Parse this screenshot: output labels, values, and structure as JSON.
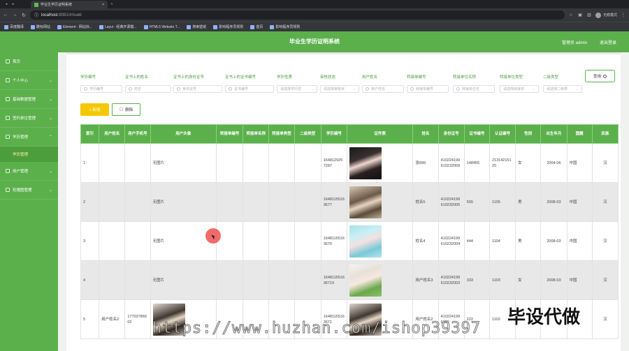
{
  "browser": {
    "tab_title": "毕业生学历证明系统",
    "url_host": "localhost",
    "url_path": ":8081/#/xueli",
    "profile": "无痕模式",
    "bookmarks": [
      "百度翻译",
      "酷标网站",
      "Element - 网站快...",
      "Layui - 经典开源模...",
      "HTML5 Website T...",
      "搜索壁纸",
      "影响程序员规则",
      "首页",
      "影响程序员规则"
    ]
  },
  "header": {
    "title": "毕业生学历证明系统",
    "user": "管理员 admin",
    "logout": "退出登录"
  },
  "sidebar": {
    "items": [
      {
        "label": "首页",
        "chevron": false
      },
      {
        "label": "个人中心",
        "chevron": true
      },
      {
        "label": "基础数据管理",
        "chevron": true
      },
      {
        "label": "签约单位管理",
        "chevron": true
      },
      {
        "label": "学历管理",
        "chevron": true
      }
    ],
    "sub_active": "学历管理",
    "items_after": [
      {
        "label": "用户管理",
        "chevron": true
      },
      {
        "label": "轮播图管理",
        "chevron": true
      }
    ]
  },
  "filters": [
    {
      "label": "学历编号",
      "placeholder": "学历编号",
      "type": "input"
    },
    {
      "label": "证书上的姓名",
      "placeholder": "姓名",
      "type": "input"
    },
    {
      "label": "证书上的身份证号",
      "placeholder": "身份证号",
      "type": "input"
    },
    {
      "label": "证书上的证书编号",
      "placeholder": "证书编号",
      "type": "input"
    },
    {
      "label": "学历性质",
      "placeholder": "请选择学历性",
      "type": "select"
    },
    {
      "label": "审核状态",
      "placeholder": "请选择审核状",
      "type": "select"
    },
    {
      "label": "用户姓名",
      "placeholder": "用户姓名",
      "type": "input"
    },
    {
      "label": "转接单编号",
      "placeholder": "转接单编号",
      "type": "input"
    },
    {
      "label": "转接单位名称",
      "placeholder": "转接单位名",
      "type": "input"
    },
    {
      "label": "转接单位类型",
      "placeholder": "请选择转接单",
      "type": "select"
    },
    {
      "label": "二级类型",
      "placeholder": "请选择二级类",
      "type": "select"
    }
  ],
  "buttons": {
    "query": "查询",
    "add": "+ 新增",
    "delete": "删除"
  },
  "table": {
    "columns": [
      "索引",
      "用户姓名",
      "用户手机号",
      "用户头像",
      "转接单编号",
      "转接单名称",
      "转接单类型",
      "二级类型",
      "学历编号",
      "证件照",
      "姓名",
      "身份证号",
      "证书编号",
      "认证编号",
      "性别",
      "出生年月",
      "国籍",
      "民族"
    ],
    "rows": [
      {
        "idx": "1",
        "uname": "",
        "phone": "",
        "avatar": "无图片",
        "no": "",
        "name": "",
        "type": "",
        "sub": "",
        "edu_no": "1648129257287",
        "photo": "p1",
        "cname": "张899",
        "idcard": "410224199610232009",
        "cert": "148455",
        "auth": "21314215125",
        "sex": "女",
        "birth": "2004-06",
        "nation": "中国",
        "ethnic": "汉"
      },
      {
        "idx": "2",
        "uname": "",
        "phone": "",
        "avatar": "无图片",
        "no": "",
        "name": "",
        "type": "",
        "sub": "",
        "edu_no": "16481155163677",
        "photo": "p2",
        "cname": "姓名5",
        "idcard": "410224199610232005",
        "cert": "555",
        "auth": "1105",
        "sex": "男",
        "birth": "2008-03",
        "nation": "中国",
        "ethnic": "汉"
      },
      {
        "idx": "3",
        "uname": "",
        "phone": "",
        "avatar": "无图片",
        "no": "",
        "name": "",
        "type": "",
        "sub": "",
        "edu_no": "16481155163670",
        "photo": "p3",
        "cname": "姓名4",
        "idcard": "410224199610232004",
        "cert": "444",
        "auth": "1104",
        "sex": "男",
        "birth": "2008-03",
        "nation": "中国",
        "ethnic": "汉"
      },
      {
        "idx": "4",
        "uname": "",
        "phone": "",
        "avatar": "无图片",
        "no": "",
        "name": "",
        "type": "",
        "sub": "",
        "edu_no": "164811551636719",
        "photo": "p4",
        "cname": "用户姓名3",
        "idcard": "410224199610232003",
        "cert": "333",
        "auth": "1103",
        "sex": "女",
        "birth": "2008-03",
        "nation": "中国",
        "ethnic": "汉"
      },
      {
        "idx": "5",
        "uname": "用户姓名2",
        "phone": "17703786902",
        "avatar": "",
        "no": "",
        "name": "",
        "type": "",
        "sub": "",
        "edu_no": "16481155163671",
        "photo": "p5",
        "cname": "用户姓名2",
        "idcard": "4102241996102",
        "cert": "222",
        "auth": "1102",
        "sex": "",
        "birth": "",
        "nation": "",
        "ethnic": "汉"
      }
    ]
  },
  "watermark_url": "https://www.huzhan.com/ishop39397",
  "watermark_cn": "毕设代做"
}
